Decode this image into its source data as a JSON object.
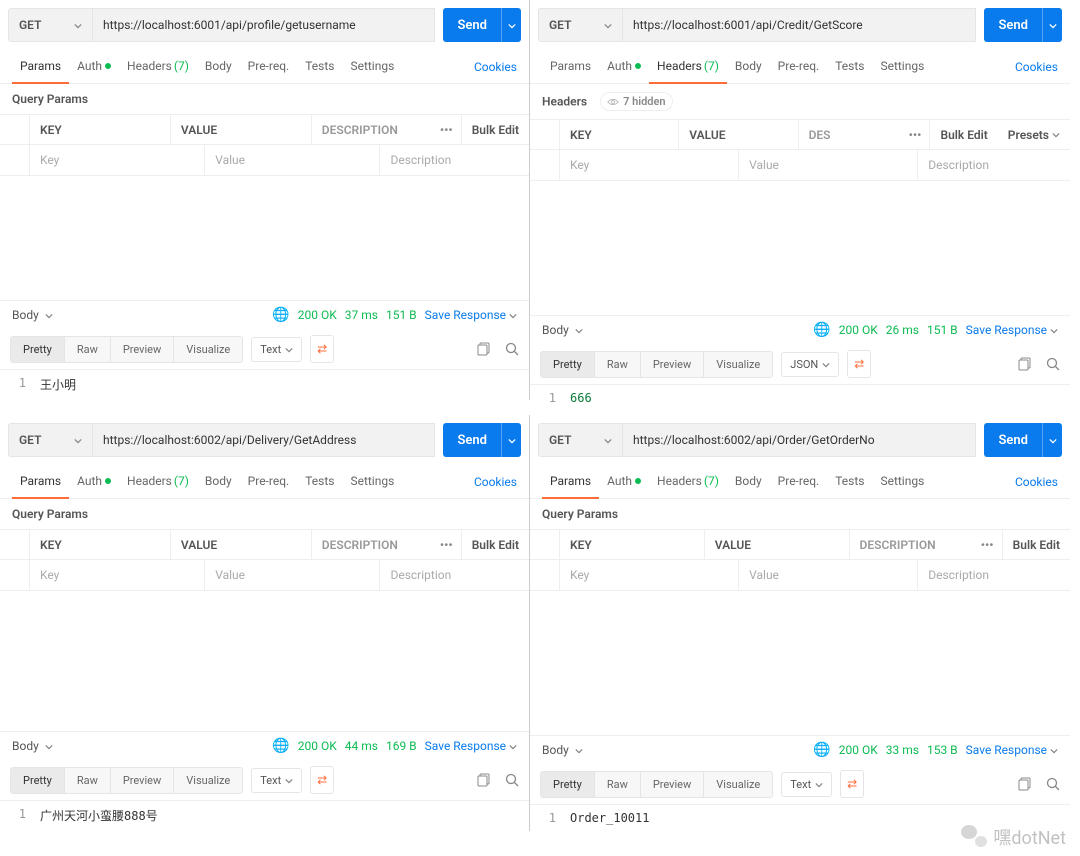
{
  "panels": [
    {
      "method": "GET",
      "url": "https://localhost:6001/api/profile/getusername",
      "send": "Send",
      "active_tab": "Params",
      "query_section": "Query Params",
      "hidden_label": null,
      "headers": {
        "key": "KEY",
        "value": "VALUE",
        "desc": "DESCRIPTION",
        "bulk": "Bulk Edit",
        "presets": null
      },
      "placeholders": {
        "key": "Key",
        "value": "Value",
        "desc": "Description"
      },
      "resp": {
        "body": "Body",
        "status": "200 OK",
        "time": "37 ms",
        "size": "151 B",
        "save": "Save Response"
      },
      "view": {
        "pretty": "Pretty",
        "raw": "Raw",
        "preview": "Preview",
        "visualize": "Visualize",
        "format": "Text"
      },
      "code": {
        "line": "1",
        "text": "王小明"
      }
    },
    {
      "method": "GET",
      "url": "https://localhost:6001/api/Credit/GetScore",
      "send": "Send",
      "active_tab": "Headers",
      "query_section": "Headers",
      "hidden_label": "7 hidden",
      "headers": {
        "key": "KEY",
        "value": "VALUE",
        "desc": "DES",
        "bulk": "Bulk Edit",
        "presets": "Presets"
      },
      "placeholders": {
        "key": "Key",
        "value": "Value",
        "desc": "Description"
      },
      "resp": {
        "body": "Body",
        "status": "200 OK",
        "time": "26 ms",
        "size": "151 B",
        "save": "Save Response"
      },
      "view": {
        "pretty": "Pretty",
        "raw": "Raw",
        "preview": "Preview",
        "visualize": "Visualize",
        "format": "JSON"
      },
      "code": {
        "line": "1",
        "text": "666"
      }
    },
    {
      "method": "GET",
      "url": "https://localhost:6002/api/Delivery/GetAddress",
      "send": "Send",
      "active_tab": "Params",
      "query_section": "Query Params",
      "hidden_label": null,
      "headers": {
        "key": "KEY",
        "value": "VALUE",
        "desc": "DESCRIPTION",
        "bulk": "Bulk Edit",
        "presets": null
      },
      "placeholders": {
        "key": "Key",
        "value": "Value",
        "desc": "Description"
      },
      "resp": {
        "body": "Body",
        "status": "200 OK",
        "time": "44 ms",
        "size": "169 B",
        "save": "Save Response"
      },
      "view": {
        "pretty": "Pretty",
        "raw": "Raw",
        "preview": "Preview",
        "visualize": "Visualize",
        "format": "Text"
      },
      "code": {
        "line": "1",
        "text": "广州天河小蛮腰888号"
      }
    },
    {
      "method": "GET",
      "url": "https://localhost:6002/api/Order/GetOrderNo",
      "send": "Send",
      "active_tab": "Params",
      "query_section": "Query Params",
      "hidden_label": null,
      "headers": {
        "key": "KEY",
        "value": "VALUE",
        "desc": "DESCRIPTION",
        "bulk": "Bulk Edit",
        "presets": null
      },
      "placeholders": {
        "key": "Key",
        "value": "Value",
        "desc": "Description"
      },
      "resp": {
        "body": "Body",
        "status": "200 OK",
        "time": "33 ms",
        "size": "153 B",
        "save": "Save Response"
      },
      "view": {
        "pretty": "Pretty",
        "raw": "Raw",
        "preview": "Preview",
        "visualize": "Visualize",
        "format": "Text"
      },
      "code": {
        "line": "1",
        "text": "Order_10011"
      }
    }
  ],
  "tabs": {
    "params": "Params",
    "auth": "Auth",
    "headers": "Headers",
    "headers_count": "(7)",
    "body": "Body",
    "prereq": "Pre-req.",
    "tests": "Tests",
    "settings": "Settings",
    "cookies": "Cookies"
  },
  "watermark": "嘿dotNet"
}
